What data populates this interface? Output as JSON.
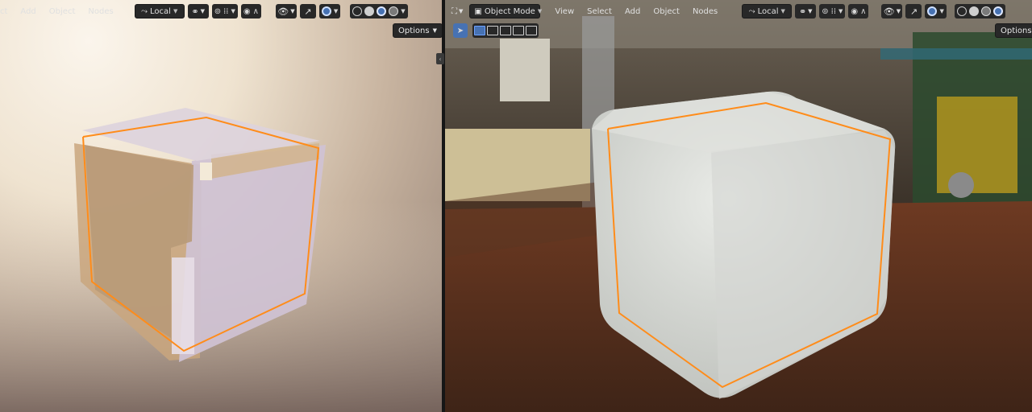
{
  "left_header": {
    "menus": [
      "ct",
      "Add",
      "Object",
      "Nodes"
    ],
    "transform_orientation": "Local",
    "options_label": "Options"
  },
  "right_header": {
    "mode": "Object Mode",
    "menus": [
      "View",
      "Select",
      "Add",
      "Object",
      "Nodes"
    ],
    "transform_orientation": "Local",
    "options_label": "Options"
  },
  "colors": {
    "header_bg": "#1d1d1d",
    "button_bg": "#282828",
    "active_blue": "#4772b3",
    "selection_outline": "#ff8c1a"
  },
  "icons": {
    "orientation": "orientation-icon",
    "snap": "magnet-icon",
    "proportional": "proportional-edit-icon",
    "visibility": "eye-icon",
    "gizmo": "gizmo-icon",
    "overlay": "overlay-icon",
    "shading_modes": [
      "wireframe-icon",
      "solid-icon",
      "material-icon",
      "rendered-icon"
    ]
  }
}
